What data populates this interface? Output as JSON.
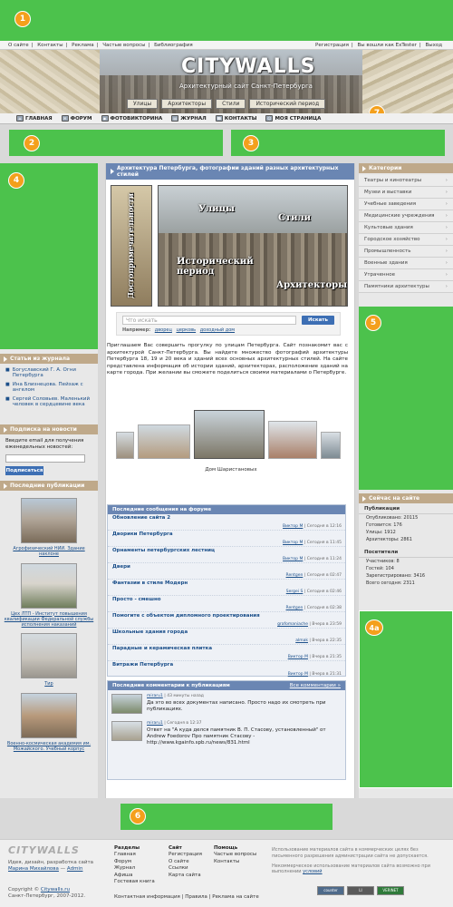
{
  "badges": {
    "b1": "1",
    "b2": "2",
    "b3": "3",
    "b4": "4",
    "b5": "5",
    "b6": "6",
    "b7": "7",
    "b4a": "4a"
  },
  "topbar": {
    "left": [
      "О сайте",
      "Контакты",
      "Реклама",
      "Частые вопросы",
      "Библиография"
    ],
    "right": [
      "Регистрация",
      "Вы вошли как ExTester",
      "Выход"
    ]
  },
  "header": {
    "logo": "CITYWALLS",
    "tagline": "Архитектурный сайт Санкт-Петербурга",
    "tabs": [
      "Улицы",
      "Архитекторы",
      "Стили",
      "Исторический период"
    ]
  },
  "mainnav": [
    "ГЛАВНАЯ",
    "ФОРУМ",
    "ФОТОВИКТОРИНА",
    "ЖУРНАЛ",
    "КОНТАКТЫ",
    "МОЯ СТРАНИЦА"
  ],
  "left": {
    "journal_title": "Статьи из журнала",
    "journal_items": [
      "Богуславский Г. А. Огни Петербурга",
      "Ина Близнецова. Пейзаж с ангелом",
      "Сергей Соловьев. Маленький человек в сердцевине века"
    ],
    "subscribe_title": "Подписка на новости",
    "subscribe_text": "Введите email для получения еженедельных новостей:",
    "subscribe_button": "Подписаться",
    "pubs_title": "Последние публикации",
    "pubs": [
      "Агрофизический НИИ. Здание наклоне",
      "Цех ЛТП - Институт повышения квалификации Федеральной службы исполнения наказаний",
      "Тир",
      "Военно-космическая академия им. Можайского. Учебный корпус"
    ]
  },
  "center": {
    "title": "Архитектура Петербурга, фотографии зданий разных архитектурных стилей",
    "collage": {
      "vertical": "Достопримечательности",
      "streets": "Улицы",
      "styles": "Стили",
      "period": "Исторический период",
      "architects": "Архитекторы"
    },
    "search": {
      "placeholder": "Что искать",
      "button": "Искать",
      "hint_label": "Например:",
      "hints": [
        "дворец",
        "церковь",
        "доходный дом"
      ]
    },
    "intro": "Приглашаем Вас совершить прогулку по улицам Петербурга. Сайт познакомит вас с архитектурой Санкт-Петербурга. Вы найдете множество фотографий архитектуры Петербурга 18, 19 и 20 века и зданий всех основных архитектурных стилей. На сайте представлена информация об истории зданий, архитекторах, расположение зданий на карте города. При желании вы сможете поделиться своими материалами о Петербурге.",
    "photo_caption": "Дом Шаристановых",
    "forum_title": "Последние сообщения на форуме",
    "forum": [
      {
        "title": "Обновление сайта 2",
        "user": "Виктор М",
        "time": "Сегодня в 12:16"
      },
      {
        "title": "Дворики Петербурга",
        "user": "Виктор М",
        "time": "Сегодня в 11:45"
      },
      {
        "title": "Орнаменты петербургских лестниц",
        "user": "Виктор М",
        "time": "Сегодня в 11:24"
      },
      {
        "title": "Двери",
        "user": "Rentgen",
        "time": "Сегодня в 02:47"
      },
      {
        "title": "Фантазии в стиле Модерн",
        "user": "Sergei S",
        "time": "Сегодня в 02:46"
      },
      {
        "title": "Просто - смешно",
        "user": "Rentgen",
        "time": "Сегодня в 02:38"
      },
      {
        "title": "Помогите с объектом дипломного проектирования",
        "user": "grafomaniache",
        "time": "Вчера в 23:59"
      },
      {
        "title": "Школьные здания города",
        "user": "almak",
        "time": "Вчера в 22:35"
      },
      {
        "title": "Парадные и керамическая плитка",
        "user": "Виктор М",
        "time": "Вчера в 21:35"
      },
      {
        "title": "Витражи Петербурга",
        "user": "Виктор М",
        "time": "Вчера в 21:31"
      }
    ],
    "comments_title": "Последние комментарии к публикациям",
    "comments_all": "Все комментарии »",
    "comments": [
      {
        "user": "miraru1",
        "time": "43 минуты назад",
        "text": "Да это во всех документах написано. Просто надо их смотреть при публикациях."
      },
      {
        "user": "miraru1",
        "time": "Сегодня в 12:37",
        "text": "Ответ на \"А куда делся памятник В. П. Стасову, установленный\" от Andrew Foedorov Про памятник Стасову - http://www.kgainfo.spb.ru/news/831.html"
      }
    ]
  },
  "right": {
    "cat_title": "Категории",
    "categories": [
      "Театры и кинотеатры",
      "Музеи и выставки",
      "Учебные заведения",
      "Медицинские учреждения",
      "Культовые здания",
      "Городское хозяйство",
      "Промышленность",
      "Военные здания",
      "Утраченное",
      "Памятники архитектуры"
    ],
    "online_title": "Сейчас на сайте",
    "pubs_sub": "Публикации",
    "pubs_stats": [
      "Опубликовано: 20115",
      "Готовится: 176",
      "Улицы: 1912",
      "Архитекторы: 2861"
    ],
    "visitors_sub": "Посетители",
    "visitor_stats": [
      "Участников: 8",
      "Гостей: 104",
      "Зарегистрировано: 3416",
      "Всего сегодня: 2311"
    ]
  },
  "footer": {
    "logo": "CITYWALLS",
    "design": "Идея, дизайн, разработка сайта",
    "designer": "Марина Михайлова",
    "and": " — ",
    "admin": "Admin",
    "copy1": "Copyright ©",
    "copy_site": "Citywalls.ru",
    "copy2": "Санкт-Петербург, 2007-2012.",
    "col1_title": "Разделы",
    "col1": [
      "Главная",
      "Форум",
      "Журнал",
      "Афиша",
      "Гостевая книга"
    ],
    "col2_title": "Сайт",
    "col2": [
      "Регистрация",
      "О сайте",
      "Ссылки",
      "Карта сайта"
    ],
    "col3_title": "Помощь",
    "col3": [
      "Частые вопросы",
      "Контакты"
    ],
    "note1": "Использование материалов сайта в коммерческих целях без письменного разрешения администрации сайта не допускается.",
    "note2": "Некоммерческое использование материалов сайта возможно при выполнении",
    "note2_link": "условий",
    "bottom": "Контактная информация | Правила | Реклама на сайте",
    "counters": [
      "counter",
      "LI",
      "VERINET"
    ]
  }
}
